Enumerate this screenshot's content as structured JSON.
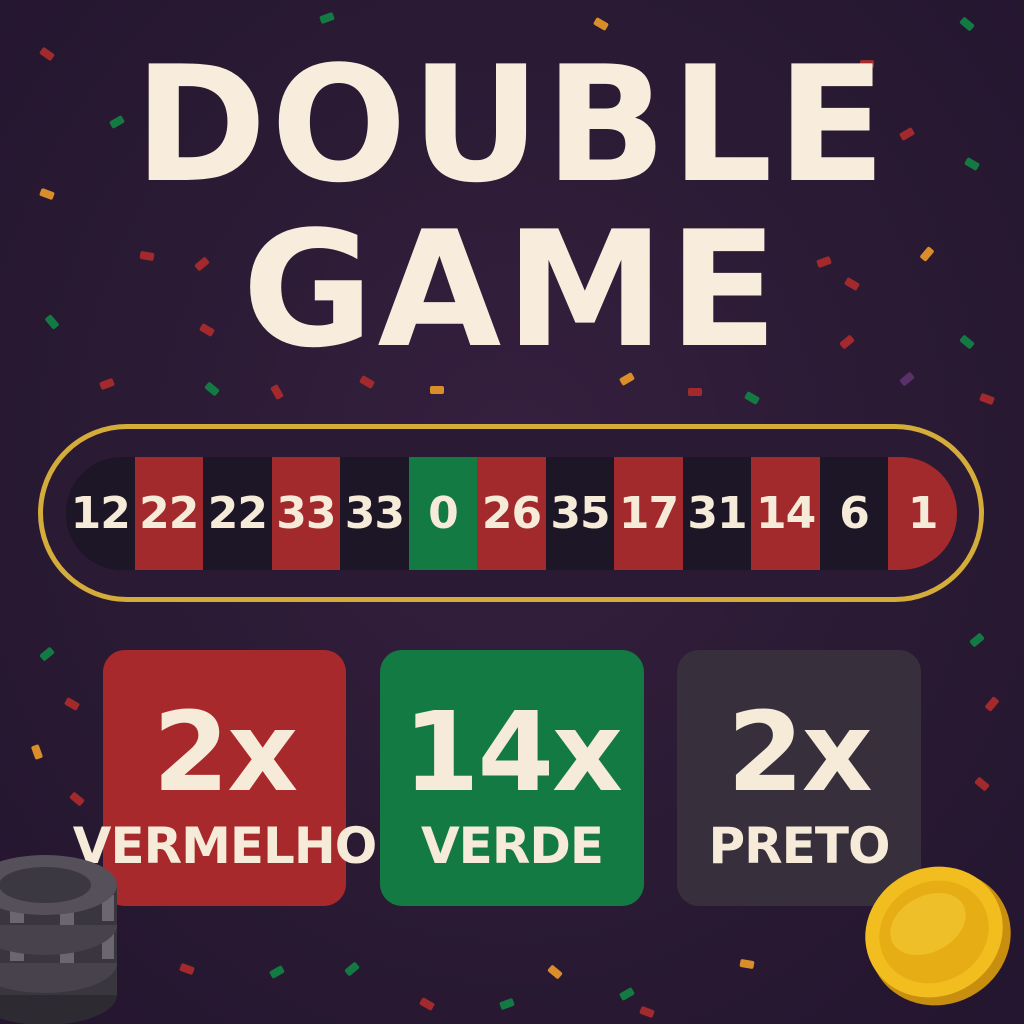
{
  "title": {
    "line1": "DOUBLE",
    "line2": "GAME"
  },
  "roulette_strip": {
    "cells": [
      {
        "number": "12",
        "color": "black"
      },
      {
        "number": "22",
        "color": "red"
      },
      {
        "number": "22",
        "color": "black"
      },
      {
        "number": "33",
        "color": "red"
      },
      {
        "number": "33",
        "color": "black"
      },
      {
        "number": "0",
        "color": "green"
      },
      {
        "number": "26",
        "color": "red"
      },
      {
        "number": "35",
        "color": "black"
      },
      {
        "number": "17",
        "color": "red"
      },
      {
        "number": "31",
        "color": "black"
      },
      {
        "number": "14",
        "color": "red"
      },
      {
        "number": "6",
        "color": "black"
      },
      {
        "number": "1",
        "color": "red"
      }
    ]
  },
  "bets": {
    "red": {
      "multiplier": "2x",
      "label": "VERMELHO"
    },
    "green": {
      "multiplier": "14x",
      "label": "VERDE"
    },
    "black": {
      "multiplier": "2x",
      "label": "PRETO"
    }
  },
  "colors": {
    "background": "#2a1a33",
    "red": "#a8292b",
    "green": "#137a44",
    "black": "#37303c",
    "gold": "#d4ac3a",
    "text": "#f8ecdc"
  },
  "decorations": [
    "poker-chip-stack-icon",
    "gold-coin-icon",
    "confetti"
  ]
}
